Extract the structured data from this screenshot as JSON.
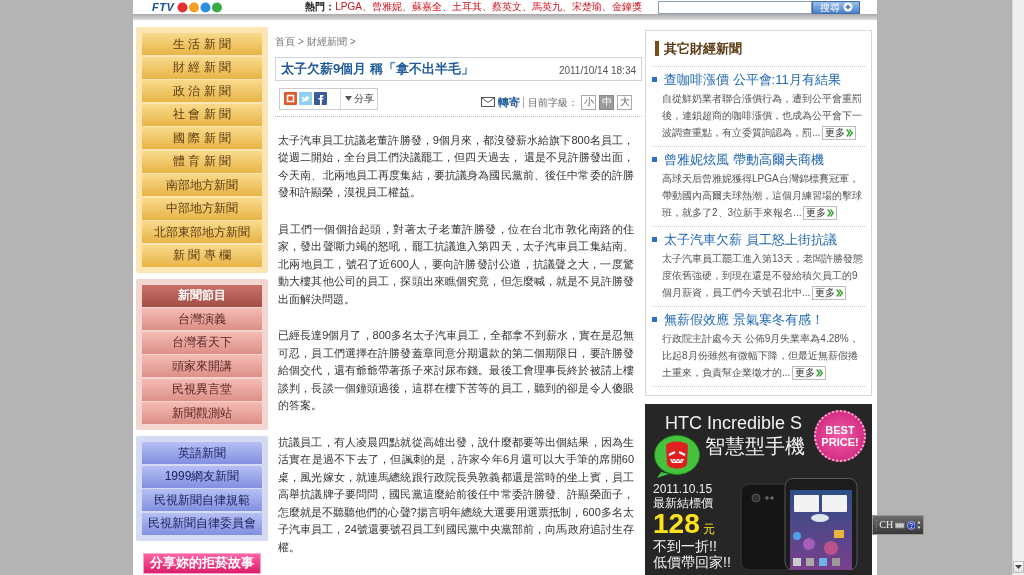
{
  "header": {
    "logo": "FTV",
    "hot_label": "熱門：",
    "hot_links": [
      {
        "label": "LPGA",
        "separator": "、"
      },
      {
        "label": "曾雅妮",
        "separator": "、"
      },
      {
        "label": "蘇嘉全",
        "separator": "、"
      },
      {
        "label": "土耳其",
        "separator": "、"
      },
      {
        "label": "蔡英文",
        "separator": "、"
      },
      {
        "label": "馬英九",
        "separator": "、"
      },
      {
        "label": "宋楚瑜",
        "separator": "、"
      },
      {
        "label": "金鐘獎"
      }
    ],
    "search_button": "搜尋"
  },
  "sidebar": {
    "sections": [
      {
        "kind": "gold",
        "items": [
          "生 活 新 聞",
          "財 經 新 聞",
          "政 治 新 聞",
          "社 會 新 聞",
          "國 際 新 聞",
          "體 育 新 聞",
          "南部地方新聞",
          "中部地方新聞",
          "北部東部地方新聞",
          "新 聞 專 欄"
        ]
      },
      {
        "kind": "rose",
        "title": "新聞節目",
        "items": [
          "台灣演義",
          "台灣看天下",
          "頭家來開講",
          "民視異言堂",
          "新聞觀測站"
        ]
      },
      {
        "kind": "blue",
        "items": [
          "英語新聞",
          "1999網友新聞",
          "民視新聞自律規範",
          "民視新聞自律委員會"
        ]
      }
    ],
    "banner": "分享妳的拒菸故事"
  },
  "article": {
    "breadcrumb": [
      {
        "label": "首頁",
        "separator": ">"
      },
      {
        "label": "財經新聞",
        "separator": ">"
      }
    ],
    "title": "太子欠薪9個月 稱「拿不出半毛」",
    "date": "2011/10/14 18:34",
    "share_button": "分享",
    "forward_link": "轉寄",
    "font_size_label": "目前字級：",
    "font_sizes": [
      {
        "label": "小",
        "selected": false
      },
      {
        "label": "中",
        "selected": true
      },
      {
        "label": "大",
        "selected": false
      }
    ],
    "paragraphs": [
      "太子汽車員工抗議老董許勝發，9個月來，都沒發薪水給旗下800名員工，從週二開始，全台員工們決議罷工，但四天過去， 還是不見許勝發出面，今天南、北兩地員工再度集結，要抗議身為國民黨前、後任中常委的許勝發和許顯榮，漠視員工權益。",
      "員工們一個個抬起頭，對著太子老董許勝發，位在台北市敦化南路的住家，發出聲嘶力竭的怒吼，罷工抗議進入第四天，太子汽車員工集結南、北兩地員工，號召了近600人，要向許勝發討公道，抗議聲之大，一度驚動大樓其他公司的員工，探頭出來瞧個究竟，但怎麼喊，就是不見許勝發出面解決問題。",
      "已經長達9個月了，800多名太子汽車員工，全都拿不到薪水，實在是忍無可忍，員工們選擇在許勝發蓋章同意分期還款的第二個期限日，要許勝發給個交代，還有爺爺帶著孫子來討尿布錢。最後工會理事長終於被請上樓談判，長談一個鐘頭過後，這群在樓下苦等的員工，聽到的卻是令人傻眼的答案。",
      "抗議員工，有人凌晨四點就從高雄出發，說什麼都要等出個結果，因為生活實在是過不下去了，但諷刺的是，許家今年6月還可以大手筆的席開60桌，風光嫁女，就連馬總統跟行政院長吳敦義都還是當時的坐上賓，員工高舉抗議牌子要問問，國民黨這麼給前後任中常委許勝發、許顯榮面子，怎麼就是不聽聽他們的心聲?揚言明年總統大選要用選票抵制，600多名太子汽車員工，24號還要號召員工到國民黨中央黨部前，向馬政府追討生存權。"
    ]
  },
  "related_news": {
    "title": "其它財經新聞",
    "items": [
      {
        "title": "查咖啡漲價 公平會:11月有結果",
        "summary": "自從鮮奶業者聯合漲價行為，遭到公平會重罰後，連鎖超商的咖啡漲價，也成為公平會下一波調查重點，有立委質詢認為，罰...",
        "more": "更多"
      },
      {
        "title": "曾雅妮炫風 帶動高爾夫商機",
        "summary": "高球天后曾雅妮獲得LPGA台灣錦標賽冠軍，帶動國內高爾夫球熱潮，這個月練習場的擊球班，就多了2、3位新手來報名...",
        "more": "更多"
      },
      {
        "title": "太子汽車欠薪 員工怒上街抗議",
        "summary": "太子汽車員工罷工進入第13天，老闆許勝發態度依舊強硬，到現在還是不發給積欠員工的9個月薪資，員工們今天號召北中...",
        "more": "更多"
      },
      {
        "title": "無薪假效應 景氣寒冬有感！",
        "summary": "行政院主計處今天 公佈9月失業率為4.28%，比起8月份雖然有微幅下降，但最近無薪假捲土重來，負責幫企業徵才的...",
        "more": "更多"
      }
    ]
  },
  "advertisement": {
    "title": "HTC Incredible S",
    "subtitle": "智慧型手機",
    "badge": "BEST PRICE!",
    "date": "2011.10.15",
    "price_label": "最新結標價",
    "price": "128",
    "currency": "元",
    "slogans": [
      "不到一折!!",
      "低價帶回家!!"
    ]
  },
  "ime_toolbar": {
    "language": "CH"
  }
}
